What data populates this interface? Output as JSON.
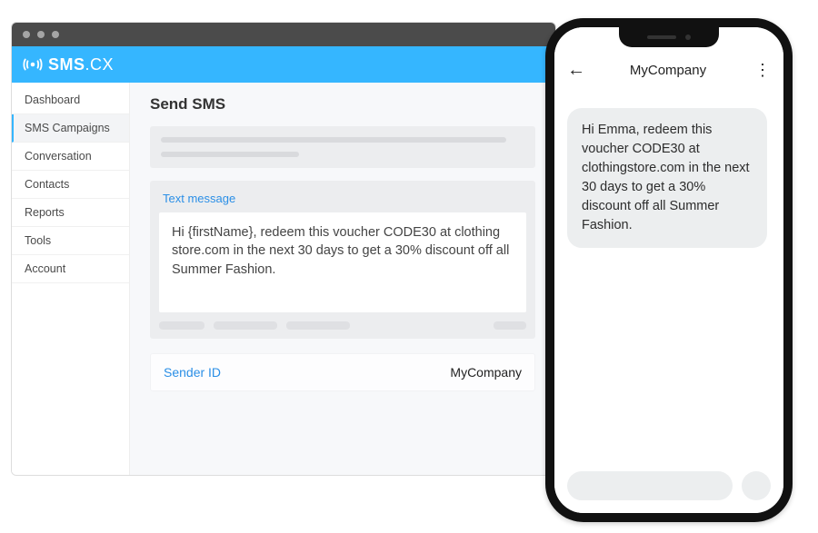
{
  "logo": {
    "brand": "SMS",
    "suffix": ".CX"
  },
  "sidebar": {
    "items": [
      {
        "label": "Dashboard"
      },
      {
        "label": "SMS Campaigns"
      },
      {
        "label": "Conversation"
      },
      {
        "label": "Contacts"
      },
      {
        "label": "Reports"
      },
      {
        "label": "Tools"
      },
      {
        "label": "Account"
      }
    ],
    "active_index": 1
  },
  "main": {
    "title": "Send SMS",
    "text_message_label": "Text message",
    "text_message_body": "Hi {firstName}, redeem this voucher CODE30 at clothing store.com in the next 30 days to get a 30% discount off all Summer Fashion.",
    "sender_id_label": "Sender ID",
    "sender_id_value": "MyCompany"
  },
  "phone": {
    "sender": "MyCompany",
    "message": "Hi Emma, redeem this voucher CODE30 at clothingstore.com in the next 30 days to get a 30% discount off all Summer Fashion."
  }
}
